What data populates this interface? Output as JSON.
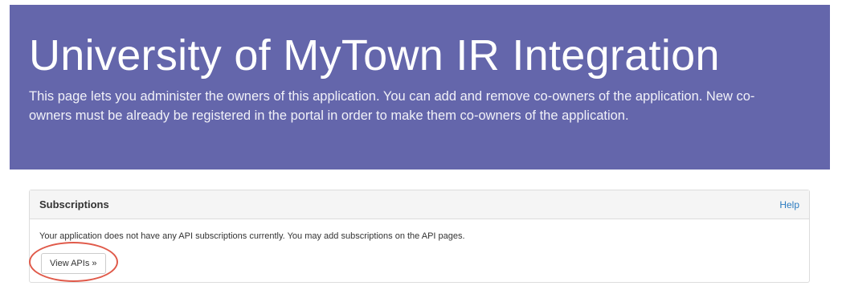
{
  "header": {
    "title": "University of MyTown IR Integration",
    "description": "This page lets you administer the owners of this application. You can add and remove co-owners of the application. New co-owners must be already be registered in the portal in order to make them co-owners of the application."
  },
  "subscriptions": {
    "title": "Subscriptions",
    "help_label": "Help",
    "message": "Your application does not have any API subscriptions currently. You may add subscriptions on the API pages.",
    "view_apis_label": "View APIs »"
  },
  "colors": {
    "hero_background": "#6466ab",
    "annotation_ring": "#e05a4a",
    "link": "#2a7bc0"
  }
}
